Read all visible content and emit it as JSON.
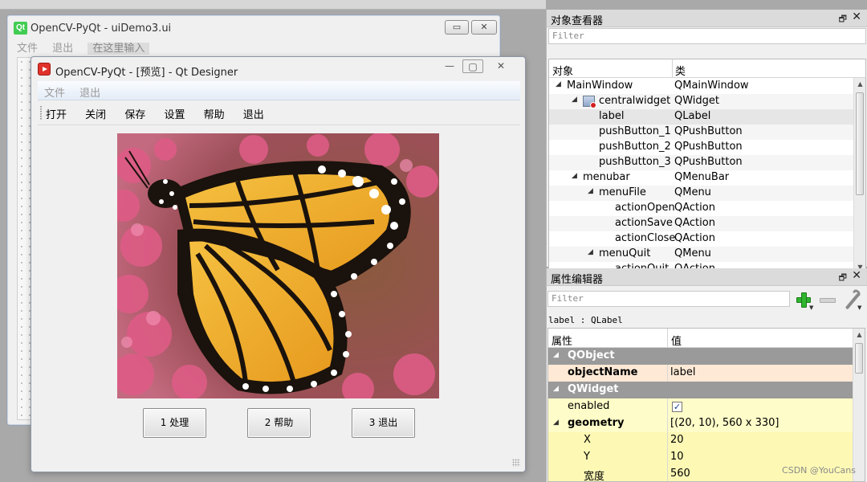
{
  "back_window": {
    "title": "OpenCV-PyQt - uiDemo3.ui",
    "menu": [
      "文件",
      "退出"
    ],
    "menu_hint": "在这里输入",
    "controls": {
      "minimize": "▭",
      "close": "✕"
    }
  },
  "preview_window": {
    "title": "OpenCV-PyQt - [预览] - Qt Designer",
    "controls": {
      "minimize": "—",
      "maximize": "▢",
      "close": "✕"
    },
    "menu": [
      "文件",
      "退出"
    ],
    "toolbar": [
      "打开",
      "关闭",
      "保存",
      "设置",
      "帮助",
      "退出"
    ],
    "buttons": [
      "1 处理",
      "2 帮助",
      "3 退出"
    ],
    "image": {
      "subject": "monarch butterfly on pink flowers",
      "colors": {
        "wing": "#f0b02a",
        "vein": "#1a120c",
        "flower": "#d6547a",
        "background": "#8a5a3e"
      }
    }
  },
  "object_inspector": {
    "title": "对象查看器",
    "filter_placeholder": "Filter",
    "columns": [
      "对象",
      "类"
    ],
    "rows": [
      {
        "name": "MainWindow",
        "class": "QMainWindow",
        "depth": 0,
        "arrow": "◢"
      },
      {
        "name": "centralwidget",
        "class": "QWidget",
        "depth": 1,
        "arrow": "◢"
      },
      {
        "name": "label",
        "class": "QLabel",
        "depth": 2,
        "arrow": ""
      },
      {
        "name": "pushButton_1",
        "class": "QPushButton",
        "depth": 2,
        "arrow": ""
      },
      {
        "name": "pushButton_2",
        "class": "QPushButton",
        "depth": 2,
        "arrow": ""
      },
      {
        "name": "pushButton_3",
        "class": "QPushButton",
        "depth": 2,
        "arrow": ""
      },
      {
        "name": "menubar",
        "class": "QMenuBar",
        "depth": 1,
        "arrow": "◢"
      },
      {
        "name": "menuFile",
        "class": "QMenu",
        "depth": 2,
        "arrow": "◢"
      },
      {
        "name": "actionOpen",
        "class": "QAction",
        "depth": 3,
        "arrow": ""
      },
      {
        "name": "actionSave",
        "class": "QAction",
        "depth": 3,
        "arrow": ""
      },
      {
        "name": "actionClose",
        "class": "QAction",
        "depth": 3,
        "arrow": ""
      },
      {
        "name": "menuQuit",
        "class": "QMenu",
        "depth": 2,
        "arrow": "◢"
      },
      {
        "name": "actionQuit",
        "class": "QAction",
        "depth": 3,
        "arrow": ""
      }
    ]
  },
  "property_editor": {
    "title": "属性编辑器",
    "filter_placeholder": "Filter",
    "object_label": "label : QLabel",
    "columns": [
      "属性",
      "值"
    ],
    "rows": [
      {
        "name": "QObject",
        "value": "",
        "kind": "group"
      },
      {
        "name": "objectName",
        "value": "label",
        "kind": "orange"
      },
      {
        "name": "QWidget",
        "value": "",
        "kind": "group"
      },
      {
        "name": "enabled",
        "value": "✓",
        "kind": "check"
      },
      {
        "name": "geometry",
        "value": "[(20, 10), 560 x 330]",
        "kind": "expand"
      },
      {
        "name": "X",
        "value": "20",
        "kind": "sub"
      },
      {
        "name": "Y",
        "value": "10",
        "kind": "sub"
      },
      {
        "name": "宽度",
        "value": "560",
        "kind": "sub"
      }
    ]
  },
  "watermark": "CSDN @YouCans"
}
